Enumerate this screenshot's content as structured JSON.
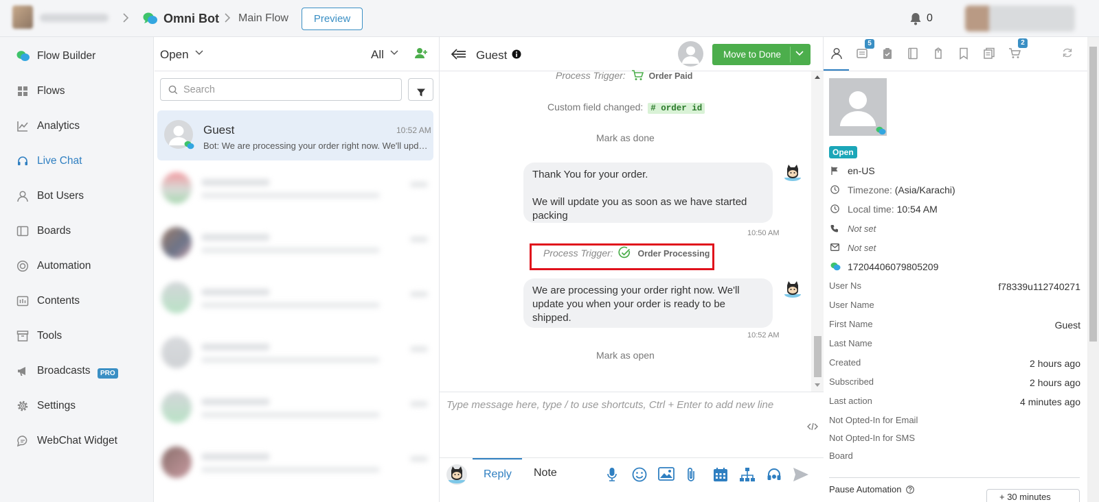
{
  "breadcrumb": {
    "bot_name": "Omni Bot",
    "flow_name": "Main Flow",
    "preview_label": "Preview"
  },
  "notifications": {
    "count": "0"
  },
  "sidebar": {
    "items": [
      {
        "label": "Flow Builder",
        "icon": "flow-builder-icon"
      },
      {
        "label": "Flows",
        "icon": "grid-icon"
      },
      {
        "label": "Analytics",
        "icon": "chart-icon"
      },
      {
        "label": "Live Chat",
        "icon": "headset-icon",
        "active": true
      },
      {
        "label": "Bot Users",
        "icon": "user-icon"
      },
      {
        "label": "Boards",
        "icon": "board-icon"
      },
      {
        "label": "Automation",
        "icon": "automation-icon"
      },
      {
        "label": "Contents",
        "icon": "contents-icon"
      },
      {
        "label": "Tools",
        "icon": "tools-icon"
      },
      {
        "label": "Broadcasts",
        "icon": "megaphone-icon",
        "badge": "PRO"
      },
      {
        "label": "Settings",
        "icon": "gear-icon"
      },
      {
        "label": "WebChat Widget",
        "icon": "chat-bubble-icon"
      }
    ]
  },
  "conversations": {
    "status_filter": "Open",
    "assign_filter": "All",
    "search_placeholder": "Search",
    "active": {
      "name": "Guest",
      "time": "10:52 AM",
      "preview": "Bot: We are processing your order right now. We'll update you when your order is ready to be shipped."
    }
  },
  "chat": {
    "title": "Guest",
    "move_to_done_label": "Move to Done",
    "events": {
      "trigger1_label": "Process Trigger:",
      "trigger1_value": "Order Paid",
      "custom_field_label": "Custom field changed:",
      "custom_field_tag": "# order id",
      "mark_done": "Mark as done",
      "trigger2_label": "Process Trigger:",
      "trigger2_value": "Order Processing",
      "mark_open": "Mark as open"
    },
    "messages": [
      {
        "line1": "Thank You for your order.",
        "line2": "We will update you as soon as we have started",
        "line3": "packing",
        "time": "10:50 AM"
      },
      {
        "line1": "We are processing your order right now. We'll",
        "line2": "update you when your order is ready to be",
        "line3": "shipped.",
        "time": "10:52 AM"
      }
    ],
    "composer_placeholder": "Type message here, type / to use shortcuts, Ctrl + Enter to add new line",
    "reply_tab": "Reply",
    "note_tab": "Note"
  },
  "profile": {
    "tab_badges": {
      "notes": "5",
      "orders": "2"
    },
    "status": "Open",
    "locale": "en-US",
    "timezone_label": "Timezone:",
    "timezone_value": "(Asia/Karachi)",
    "local_time_label": "Local time:",
    "local_time_value": "10:54 AM",
    "phone": "Not set",
    "email": "Not set",
    "user_id": "17204406079805209",
    "fields": [
      {
        "label": "User Ns",
        "value": "f78339u112740271"
      },
      {
        "label": "User Name",
        "value": ""
      },
      {
        "label": "First Name",
        "value": "Guest"
      },
      {
        "label": "Last Name",
        "value": ""
      },
      {
        "label": "Created",
        "value": "2 hours ago"
      },
      {
        "label": "Subscribed",
        "value": "2 hours ago"
      },
      {
        "label": "Last action",
        "value": "4 minutes ago"
      },
      {
        "label": "Not Opted-In for Email",
        "value": ""
      },
      {
        "label": "Not Opted-In for SMS",
        "value": ""
      },
      {
        "label": "Board",
        "value": ""
      }
    ],
    "pause_automation_label": "Pause Automation",
    "pause_select_value": "+ 30 minutes"
  },
  "colors": {
    "accent": "#2f7fc1",
    "done_green": "#4cae4c",
    "trigger_highlight": "#e0111b",
    "open_badge": "#1ba6b8"
  }
}
